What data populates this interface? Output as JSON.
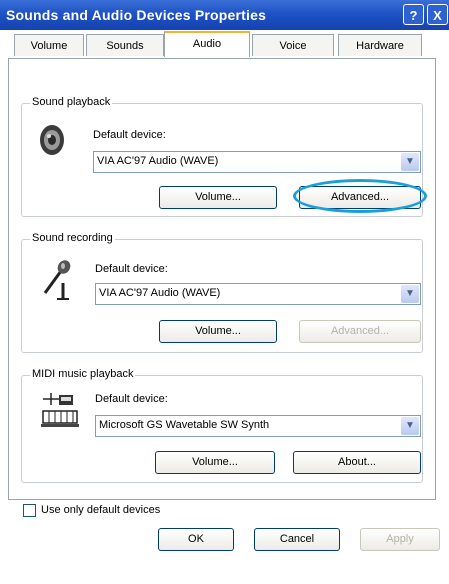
{
  "window": {
    "title": "Sounds and Audio Devices Properties",
    "help_label": "?",
    "close_label": "X"
  },
  "tabs": [
    {
      "label": "Volume",
      "active": false
    },
    {
      "label": "Sounds",
      "active": false
    },
    {
      "label": "Audio",
      "active": true
    },
    {
      "label": "Voice",
      "active": false
    },
    {
      "label": "Hardware",
      "active": false
    }
  ],
  "sound_playback": {
    "group_label": "Sound playback",
    "device_label": "Default device:",
    "device_value": "VIA AC'97 Audio (WAVE)",
    "volume_button": "Volume...",
    "advanced_button": "Advanced..."
  },
  "sound_recording": {
    "group_label": "Sound recording",
    "device_label": "Default device:",
    "device_value": "VIA AC'97 Audio (WAVE)",
    "volume_button": "Volume...",
    "advanced_button": "Advanced..."
  },
  "midi_playback": {
    "group_label": "MIDI music playback",
    "device_label": "Default device:",
    "device_value": "Microsoft GS Wavetable SW Synth",
    "volume_button": "Volume...",
    "about_button": "About..."
  },
  "options": {
    "default_only_label": "Use only default devices",
    "default_only_checked": false
  },
  "footer": {
    "ok": "OK",
    "cancel": "Cancel",
    "apply": "Apply"
  },
  "colors": {
    "titlebar": "#1f52c4",
    "highlight": "#1a9fd8",
    "active_tab_accent": "#f3b235"
  },
  "icons": {
    "playback": "speaker-icon",
    "recording": "microphone-icon",
    "midi": "keyboard-icon",
    "dropdown": "chevron-down-icon"
  }
}
